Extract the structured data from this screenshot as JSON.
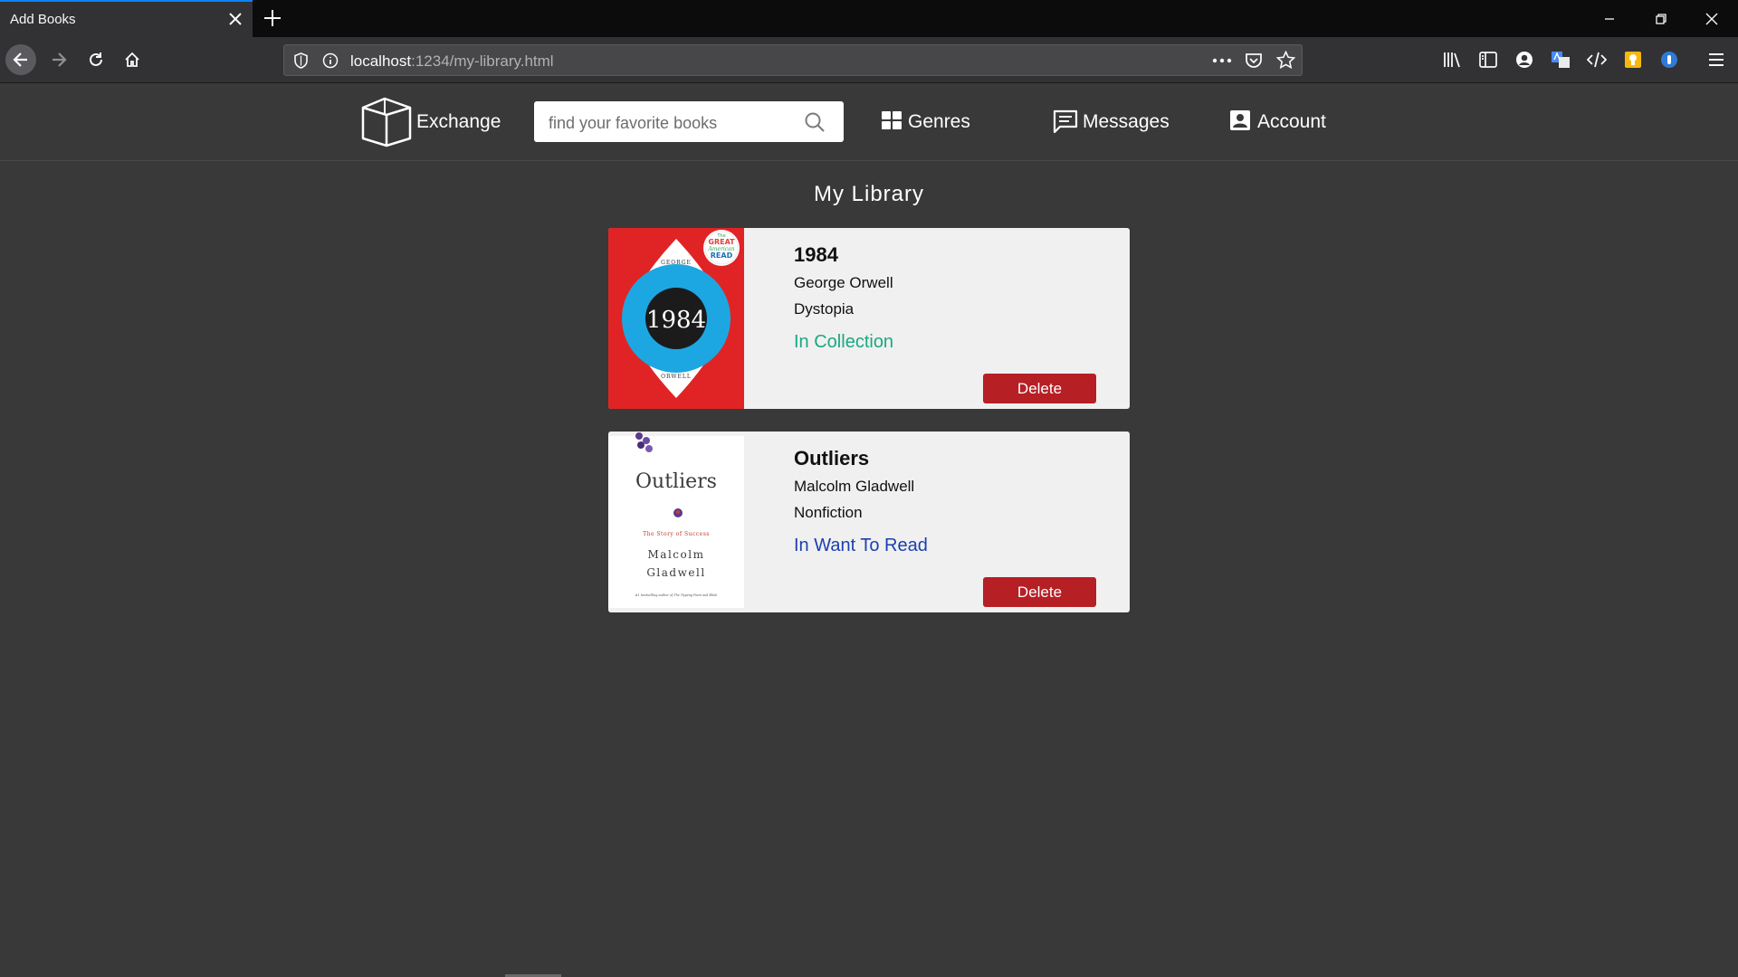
{
  "browser": {
    "tab_title": "Add Books",
    "url_host": "localhost",
    "url_path": ":1234/my-library.html"
  },
  "site": {
    "brand": "Exchange",
    "search_placeholder": "find your favorite books",
    "nav": {
      "genres": "Genres",
      "messages": "Messages",
      "account": "Account"
    }
  },
  "main": {
    "title": "My Library",
    "books": [
      {
        "title": "1984",
        "author": "George Orwell",
        "genre": "Dystopia",
        "status": "In Collection",
        "status_color": "#1aa882",
        "delete_label": "Delete",
        "cover": {
          "title": "1984",
          "top_text": "GEORGE",
          "bottom_text": "ORWELL",
          "badge_line1": "The",
          "badge_line2": "GREAT",
          "badge_line3": "American",
          "badge_line4": "READ"
        }
      },
      {
        "title": "Outliers",
        "author": "Malcolm Gladwell",
        "genre": "Nonfiction",
        "status": "In Want To Read",
        "status_color": "#1d3fae",
        "delete_label": "Delete",
        "cover": {
          "title": "Outliers",
          "subtitle": "The Story of Success",
          "author_line1": "Malcolm",
          "author_line2": "Gladwell",
          "tagline": "#1 bestselling author of The Tipping Point and Blink"
        }
      }
    ]
  },
  "colors": {
    "page_bg": "#393939",
    "delete_button": "#b61f24"
  }
}
